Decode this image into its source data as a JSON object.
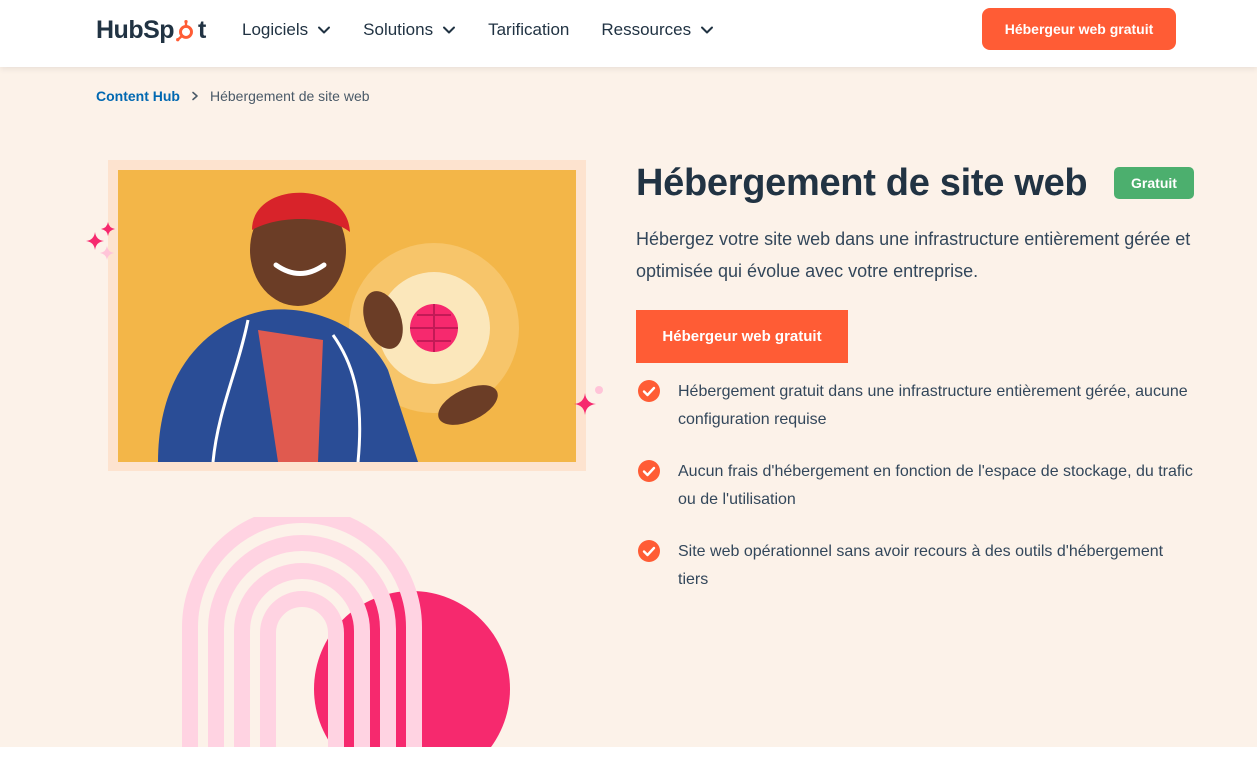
{
  "header": {
    "logo_text": "HubSpot",
    "nav": [
      {
        "label": "Logiciels",
        "has_dropdown": true
      },
      {
        "label": "Solutions",
        "has_dropdown": true
      },
      {
        "label": "Tarification",
        "has_dropdown": false
      },
      {
        "label": "Ressources",
        "has_dropdown": true
      }
    ],
    "cta_label": "Hébergeur web gratuit"
  },
  "breadcrumb": {
    "parent": "Content Hub",
    "current": "Hébergement de site web"
  },
  "hero": {
    "title": "Hébergement de site web",
    "badge": "Gratuit",
    "subtitle": "Hébergez votre site web dans une infrastructure entièrement gérée et optimisée qui évolue avec votre entreprise.",
    "cta_label": "Hébergeur web gratuit",
    "features": [
      "Hébergement gratuit dans une infrastructure entièrement gérée, aucune configuration requise",
      "Aucun frais d'hébergement en fonction de l'espace de stockage, du trafic ou de l'utilisation",
      "Site web opérationnel sans avoir recours à des outils d'hébergement tiers"
    ]
  },
  "colors": {
    "brand_orange": "#ff5c35",
    "page_background": "#fcf2e9",
    "badge_green": "#4caf6e",
    "link_blue": "#0068b1",
    "text_dark": "#213343",
    "accent_pink": "#f6296e",
    "arch_pink": "#ffd3e2"
  },
  "icons": {
    "nav_chevron": "chevron-down-icon",
    "breadcrumb_separator": "chevron-right-icon",
    "feature_bullet": "check-circle-icon",
    "logo_mark": "sprocket-icon",
    "decor": "sparkle-icon"
  }
}
